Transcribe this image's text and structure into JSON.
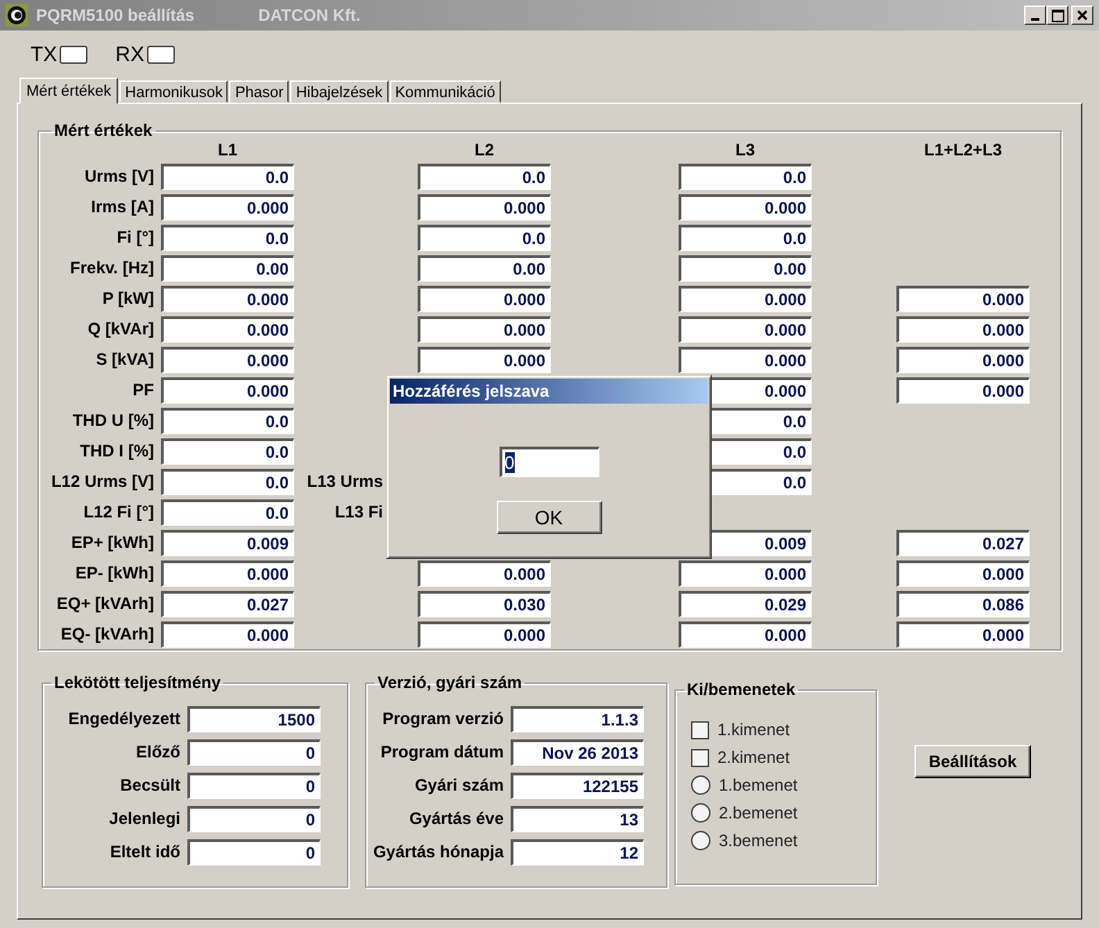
{
  "window": {
    "title": "PQRM5100 beállítás",
    "company": "DATCON Kft."
  },
  "indicators": [
    {
      "label": "TX"
    },
    {
      "label": "RX"
    }
  ],
  "tabs": [
    {
      "label": "Mért értékek",
      "selected": true
    },
    {
      "label": "Harmonikusok",
      "selected": false
    },
    {
      "label": "Phasor",
      "selected": false
    },
    {
      "label": "Hibajelzések",
      "selected": false
    },
    {
      "label": "Kommunikáció",
      "selected": false
    }
  ],
  "measured": {
    "title": "Mért értékek",
    "columns": [
      "L1",
      "L2",
      "L3",
      "L1+L2+L3"
    ],
    "rows": [
      {
        "label": "Urms [V]",
        "l1": "0.0",
        "l2": "0.0",
        "l3": "0.0"
      },
      {
        "label": "Irms [A]",
        "l1": "0.000",
        "l2": "0.000",
        "l3": "0.000"
      },
      {
        "label": "Fi [°]",
        "l1": "0.0",
        "l2": "0.0",
        "l3": "0.0"
      },
      {
        "label": "Frekv. [Hz]",
        "l1": "0.00",
        "l2": "0.00",
        "l3": "0.00"
      },
      {
        "label": "P [kW]",
        "l1": "0.000",
        "l2": "0.000",
        "l3": "0.000",
        "total": "0.000"
      },
      {
        "label": "Q [kVAr]",
        "l1": "0.000",
        "l2": "0.000",
        "l3": "0.000",
        "total": "0.000"
      },
      {
        "label": "S [kVA]",
        "l1": "0.000",
        "l2": "0.000",
        "l3": "0.000",
        "total": "0.000"
      },
      {
        "label": "PF",
        "l1": "0.000",
        "l3": "0.000",
        "total": "0.000"
      },
      {
        "label": "THD U [%]",
        "l1": "0.0",
        "l3": "0.0"
      },
      {
        "label": "THD I [%]",
        "l1": "0.0",
        "l3": "0.0"
      },
      {
        "label": "L12 Urms [V]",
        "l1": "0.0",
        "sublabel": "L13 Urms",
        "l3": "0.0"
      },
      {
        "label": "L12 Fi [°]",
        "l1": "0.0",
        "sublabel": "L13 Fi"
      },
      {
        "label": "EP+ [kWh]",
        "l1": "0.009",
        "l3": "0.009",
        "total": "0.027"
      },
      {
        "label": "EP- [kWh]",
        "l1": "0.000",
        "l2": "0.000",
        "l3": "0.000",
        "total": "0.000"
      },
      {
        "label": "EQ+ [kVArh]",
        "l1": "0.027",
        "l2": "0.030",
        "l3": "0.029",
        "total": "0.086"
      },
      {
        "label": "EQ- [kVArh]",
        "l1": "0.000",
        "l2": "0.000",
        "l3": "0.000",
        "total": "0.000"
      }
    ]
  },
  "power": {
    "title": "Lekötött teljesítmény",
    "rows": [
      {
        "label": "Engedélyezett",
        "value": "1500"
      },
      {
        "label": "Előző",
        "value": "0"
      },
      {
        "label": "Becsült",
        "value": "0"
      },
      {
        "label": "Jelenlegi",
        "value": "0"
      },
      {
        "label": "Eltelt idő",
        "value": "0"
      }
    ]
  },
  "version": {
    "title": "Verzió, gyári szám",
    "rows": [
      {
        "label": "Program verzió",
        "value": "1.1.3"
      },
      {
        "label": "Program dátum",
        "value": "Nov 26 2013"
      },
      {
        "label": "Gyári szám",
        "value": "122155"
      },
      {
        "label": "Gyártás éve",
        "value": "13"
      },
      {
        "label": "Gyártás hónapja",
        "value": "12"
      }
    ]
  },
  "io": {
    "title": "Ki/bemenetek",
    "items": [
      {
        "kind": "checkbox",
        "label": "1.kimenet",
        "checked": false
      },
      {
        "kind": "checkbox",
        "label": "2.kimenet",
        "checked": false
      },
      {
        "kind": "radio",
        "label": "1.bemenet",
        "checked": false
      },
      {
        "kind": "radio",
        "label": "2.bemenet",
        "checked": false
      },
      {
        "kind": "radio",
        "label": "3.bemenet",
        "checked": false
      }
    ]
  },
  "settings_button": "Beállítások",
  "dialog": {
    "title": "Hozzáférés jelszava",
    "value": "0",
    "button": "OK"
  }
}
